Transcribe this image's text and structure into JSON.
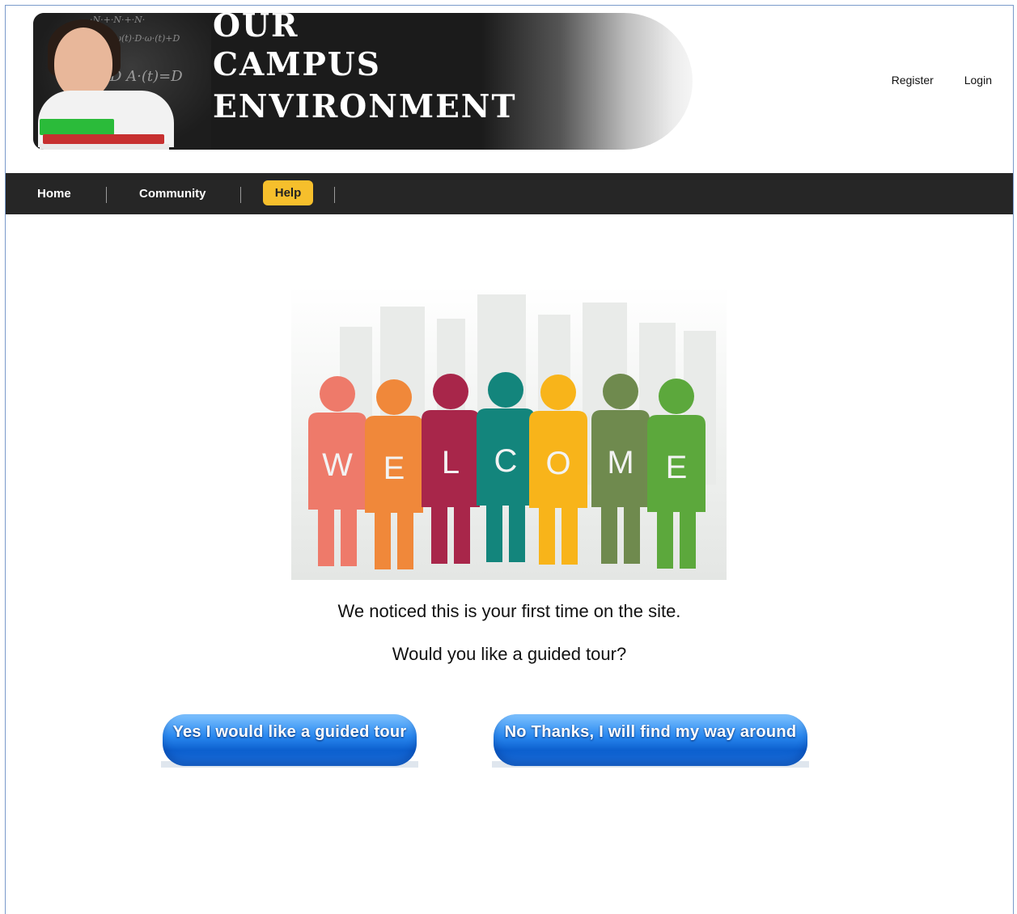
{
  "header": {
    "title_lines": [
      "OUR",
      "CAMPUS",
      "ENVIRONMENT"
    ],
    "links": {
      "register": "Register",
      "login": "Login"
    }
  },
  "nav": {
    "items": [
      {
        "label": "Home"
      },
      {
        "label": "Community"
      },
      {
        "label": "Help",
        "active": true
      }
    ],
    "active_color": "#f6bf2c",
    "bar_color": "#262626"
  },
  "main": {
    "welcome_letters": [
      "W",
      "E",
      "L",
      "C",
      "O",
      "M",
      "E"
    ],
    "message_line1": "We noticed this is your first time on the site.",
    "message_line2": "Would you like a guided tour?",
    "buttons": {
      "yes": "Yes I would like a guided tour",
      "no": "No Thanks, I will find my way around"
    }
  }
}
